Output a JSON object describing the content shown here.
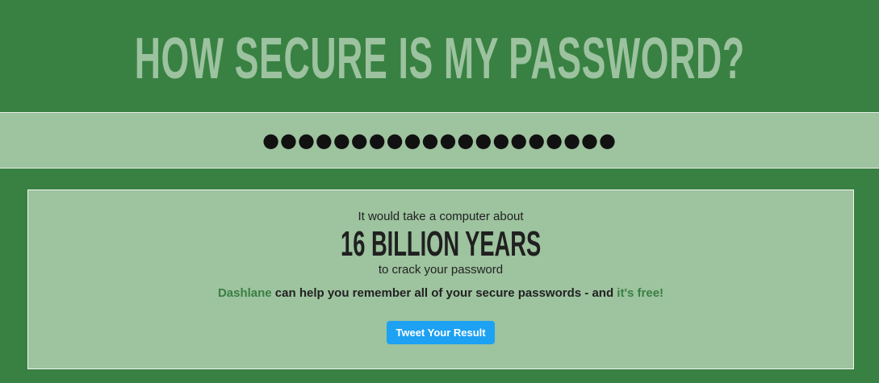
{
  "header": {
    "title": "HOW SECURE IS MY PASSWORD?"
  },
  "password": {
    "value": "●●●●●●●●●●●●●●●●●●●●"
  },
  "result": {
    "intro": "It would take a computer about",
    "time": "16 BILLION YEARS",
    "crack": "to crack your password",
    "promo": {
      "brand": "Dashlane",
      "middle": " can help you remember all of your secure passwords - and ",
      "free": "it's free!"
    },
    "tweet_label": "Tweet Your Result"
  },
  "colors": {
    "background": "#388142",
    "panel": "#9dc39f",
    "title": "#9cc29f",
    "link": "#3b7f44",
    "tweet": "#1da1f2"
  }
}
